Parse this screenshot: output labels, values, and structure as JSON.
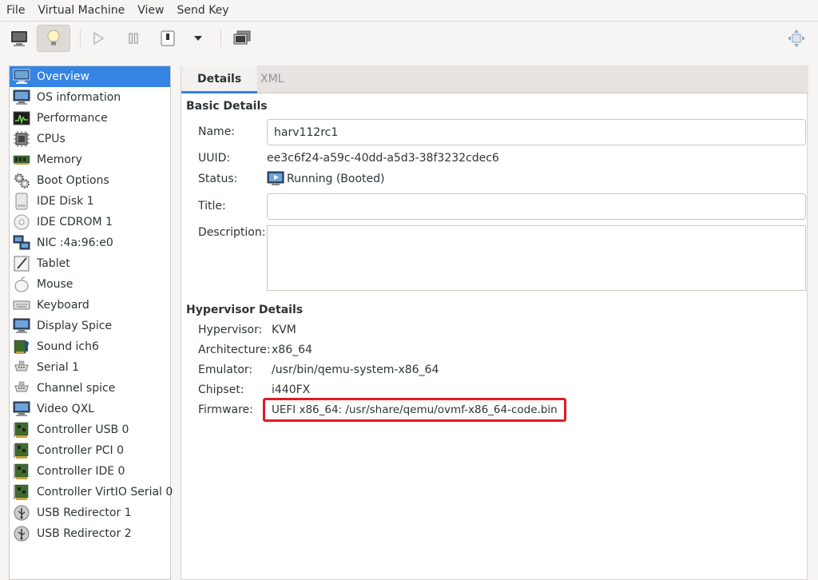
{
  "menubar": {
    "items": [
      "File",
      "Virtual Machine",
      "View",
      "Send Key"
    ]
  },
  "toolbar": {
    "buttons": [
      "console-icon",
      "lightbulb-icon",
      "play-icon",
      "pause-icon",
      "power-icon",
      "dropdown-arrow-icon",
      "snapshot-icon",
      "fullscreen-icon"
    ]
  },
  "sidebar": {
    "items": [
      {
        "label": "Overview",
        "icon": "monitor-icon"
      },
      {
        "label": "OS information",
        "icon": "monitor-icon"
      },
      {
        "label": "Performance",
        "icon": "performance-icon"
      },
      {
        "label": "CPUs",
        "icon": "cpu-icon"
      },
      {
        "label": "Memory",
        "icon": "memory-icon"
      },
      {
        "label": "Boot Options",
        "icon": "gears-icon"
      },
      {
        "label": "IDE Disk 1",
        "icon": "disk-icon"
      },
      {
        "label": "IDE CDROM 1",
        "icon": "cdrom-icon"
      },
      {
        "label": "NIC :4a:96:e0",
        "icon": "network-icon"
      },
      {
        "label": "Tablet",
        "icon": "tablet-icon"
      },
      {
        "label": "Mouse",
        "icon": "mouse-icon"
      },
      {
        "label": "Keyboard",
        "icon": "keyboard-icon"
      },
      {
        "label": "Display Spice",
        "icon": "display-icon"
      },
      {
        "label": "Sound ich6",
        "icon": "sound-icon"
      },
      {
        "label": "Serial 1",
        "icon": "serial-icon"
      },
      {
        "label": "Channel spice",
        "icon": "channel-icon"
      },
      {
        "label": "Video QXL",
        "icon": "video-icon"
      },
      {
        "label": "Controller USB 0",
        "icon": "controller-icon"
      },
      {
        "label": "Controller PCI 0",
        "icon": "controller-icon"
      },
      {
        "label": "Controller IDE 0",
        "icon": "controller-icon"
      },
      {
        "label": "Controller VirtIO Serial 0",
        "icon": "controller-icon"
      },
      {
        "label": "USB Redirector 1",
        "icon": "usb-icon"
      },
      {
        "label": "USB Redirector 2",
        "icon": "usb-icon"
      }
    ],
    "selected_index": 0
  },
  "tabs": [
    {
      "label": "Details",
      "active": true
    },
    {
      "label": "XML",
      "active": false
    }
  ],
  "basic": {
    "title": "Basic Details",
    "name_label": "Name:",
    "name_value": "harv112rc1",
    "uuid_label": "UUID:",
    "uuid_value": "ee3c6f24-a59c-40dd-a5d3-38f3232cdec6",
    "status_label": "Status:",
    "status_value": "Running (Booted)",
    "title_label": "Title:",
    "title_value": "",
    "description_label": "Description:",
    "description_value": ""
  },
  "hypervisor": {
    "title": "Hypervisor Details",
    "hypervisor_label": "Hypervisor:",
    "hypervisor_value": "KVM",
    "arch_label": "Architecture:",
    "arch_value": "x86_64",
    "emulator_label": "Emulator:",
    "emulator_value": "/usr/bin/qemu-system-x86_64",
    "chipset_label": "Chipset:",
    "chipset_value": "i440FX",
    "firmware_label": "Firmware:",
    "firmware_value": "UEFI x86_64: /usr/share/qemu/ovmf-x86_64-code.bin"
  },
  "colors": {
    "selection": "#3584e4",
    "highlight_box": "#e01b24"
  }
}
